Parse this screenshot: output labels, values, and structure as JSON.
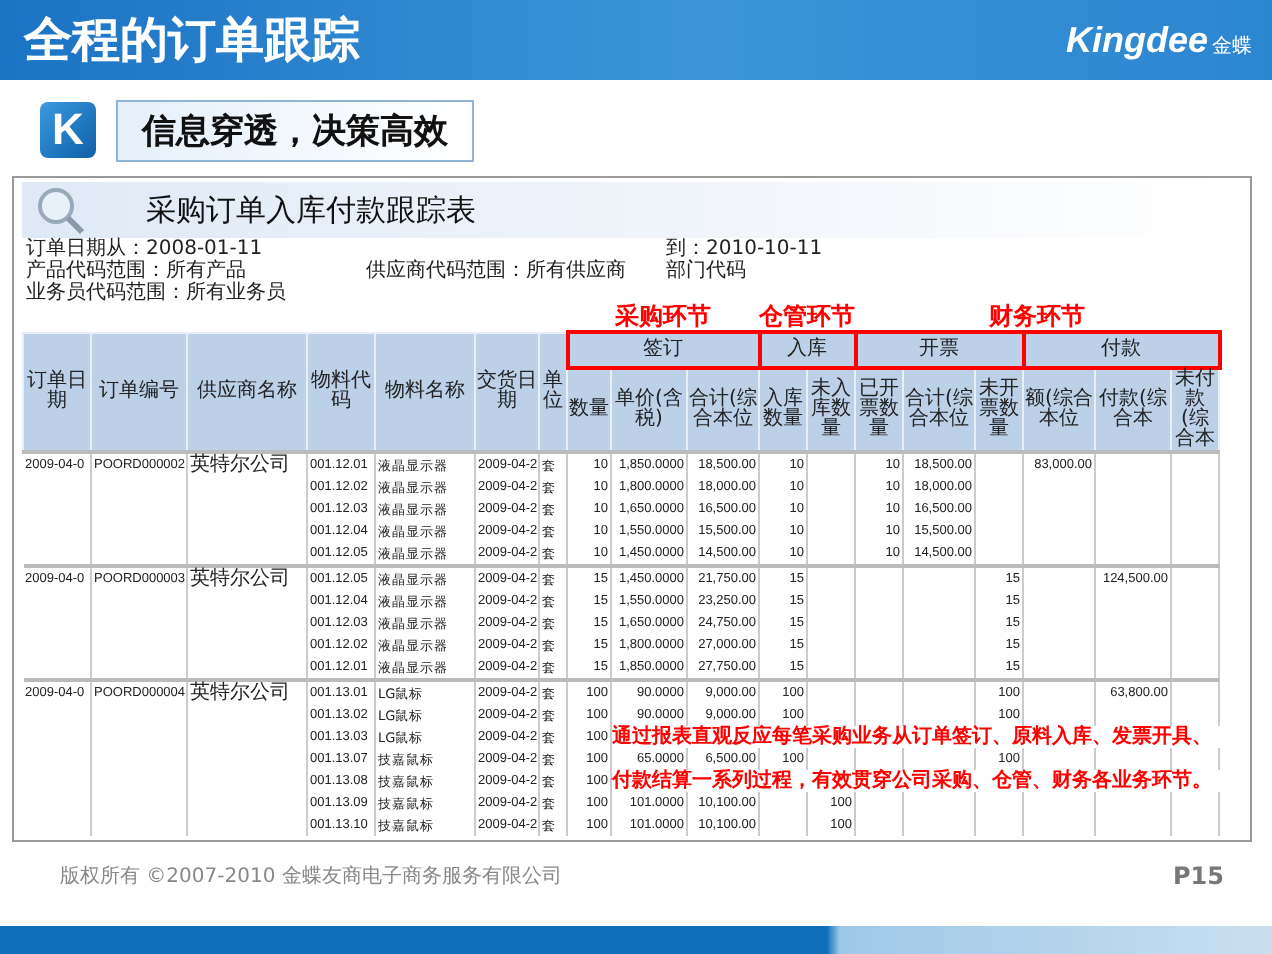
{
  "header": {
    "title": "全程的订单跟踪",
    "logo_text": "Kingdee",
    "logo_cn": "金蝶"
  },
  "subtitle": {
    "icon_letter": "K",
    "text": "信息穿透，决策高效"
  },
  "report": {
    "title": "采购订单入库付款跟踪表",
    "meta_rows": [
      [
        "订单日期从：2008-01-11",
        null,
        "到：2010-10-11"
      ],
      [
        "产品代码范围：所有产品",
        "供应商代码范围：所有供应商",
        "部门代码"
      ],
      [
        "业务员代码范围：所有业务员",
        null,
        null
      ]
    ],
    "left_columns": [
      "订单日期",
      "订单编号",
      "供应商名称",
      "物料代码",
      "物料名称",
      "交货日期",
      "单位"
    ],
    "stages": [
      {
        "label": "采购环节",
        "groups": [
          {
            "label": "签订",
            "highlighted": true,
            "columns": [
              "数量",
              "单价(含税)",
              "合计(综合本位"
            ]
          }
        ]
      },
      {
        "label": "仓管环节",
        "groups": [
          {
            "label": "入库",
            "highlighted": true,
            "columns": [
              "入库数量",
              "未入库数量"
            ]
          }
        ]
      },
      {
        "label": "财务环节",
        "groups": [
          {
            "label": "开票",
            "highlighted": true,
            "columns": [
              "已开票数量",
              "合计(综合本位",
              "未开票数量"
            ]
          },
          {
            "label": "付款",
            "highlighted": true,
            "columns": [
              "额(综合本位",
              "付款(综合本",
              "未付款(综合本"
            ]
          }
        ]
      }
    ],
    "rows": [
      {
        "kind": "data",
        "cells": [
          "2009-04-0",
          "POORD000002",
          "英特尔公司",
          "001.12.01",
          "液晶显示器",
          "2009-04-2",
          "套",
          "10",
          "1,850.0000",
          "18,500.00",
          "10",
          null,
          "10",
          "18,500.00",
          null,
          "83,000.00",
          null,
          null
        ]
      },
      {
        "kind": "data",
        "cells": [
          null,
          null,
          null,
          "001.12.02",
          "液晶显示器",
          "2009-04-2",
          "套",
          "10",
          "1,800.0000",
          "18,000.00",
          "10",
          null,
          "10",
          "18,000.00",
          null,
          null,
          null,
          null
        ]
      },
      {
        "kind": "data",
        "cells": [
          null,
          null,
          null,
          "001.12.03",
          "液晶显示器",
          "2009-04-2",
          "套",
          "10",
          "1,650.0000",
          "16,500.00",
          "10",
          null,
          "10",
          "16,500.00",
          null,
          null,
          null,
          null
        ]
      },
      {
        "kind": "data",
        "cells": [
          null,
          null,
          null,
          "001.12.04",
          "液晶显示器",
          "2009-04-2",
          "套",
          "10",
          "1,550.0000",
          "15,500.00",
          "10",
          null,
          "10",
          "15,500.00",
          null,
          null,
          null,
          null
        ]
      },
      {
        "kind": "data",
        "cells": [
          null,
          null,
          null,
          "001.12.05",
          "液晶显示器",
          "2009-04-2",
          "套",
          "10",
          "1,450.0000",
          "14,500.00",
          "10",
          null,
          "10",
          "14,500.00",
          null,
          null,
          null,
          null
        ]
      },
      {
        "kind": "data",
        "cells": [
          "2009-04-0",
          "POORD000003",
          "英特尔公司",
          "001.12.05",
          "液晶显示器",
          "2009-04-2",
          "套",
          "15",
          "1,450.0000",
          "21,750.00",
          "15",
          null,
          null,
          null,
          "15",
          null,
          "124,500.00",
          null
        ]
      },
      {
        "kind": "data",
        "cells": [
          null,
          null,
          null,
          "001.12.04",
          "液晶显示器",
          "2009-04-2",
          "套",
          "15",
          "1,550.0000",
          "23,250.00",
          "15",
          null,
          null,
          null,
          "15",
          null,
          null,
          null
        ]
      },
      {
        "kind": "data",
        "cells": [
          null,
          null,
          null,
          "001.12.03",
          "液晶显示器",
          "2009-04-2",
          "套",
          "15",
          "1,650.0000",
          "24,750.00",
          "15",
          null,
          null,
          null,
          "15",
          null,
          null,
          null
        ]
      },
      {
        "kind": "data",
        "cells": [
          null,
          null,
          null,
          "001.12.02",
          "液晶显示器",
          "2009-04-2",
          "套",
          "15",
          "1,800.0000",
          "27,000.00",
          "15",
          null,
          null,
          null,
          "15",
          null,
          null,
          null
        ]
      },
      {
        "kind": "data",
        "cells": [
          null,
          null,
          null,
          "001.12.01",
          "液晶显示器",
          "2009-04-2",
          "套",
          "15",
          "1,850.0000",
          "27,750.00",
          "15",
          null,
          null,
          null,
          "15",
          null,
          null,
          null
        ]
      },
      {
        "kind": "data",
        "cells": [
          "2009-04-0",
          "POORD000004",
          "英特尔公司",
          "001.13.01",
          "LG鼠标",
          "2009-04-2",
          "套",
          "100",
          "90.0000",
          "9,000.00",
          "100",
          null,
          null,
          null,
          "100",
          null,
          "63,800.00",
          null
        ]
      },
      {
        "kind": "data",
        "cells": [
          null,
          null,
          null,
          "001.13.02",
          "LG鼠标",
          "2009-04-2",
          "套",
          "100",
          "90.0000",
          "9,000.00",
          "100",
          null,
          null,
          null,
          "100",
          null,
          null,
          null
        ]
      },
      {
        "kind": "note",
        "cells": [
          null,
          null,
          null,
          "001.13.03",
          "LG鼠标",
          "2009-04-2",
          "套",
          "100"
        ],
        "note": "通过报表直观反应每笔采购业务从订单签订、原料入库、发票开具、"
      },
      {
        "kind": "data",
        "cells": [
          null,
          null,
          null,
          "001.13.07",
          "技嘉鼠标",
          "2009-04-2",
          "套",
          "100",
          "65.0000",
          "6,500.00",
          "100",
          null,
          null,
          null,
          "100",
          null,
          null,
          null
        ]
      },
      {
        "kind": "note",
        "cells": [
          null,
          null,
          null,
          "001.13.08",
          "技嘉鼠标",
          "2009-04-2",
          "套",
          "100"
        ],
        "note": "付款结算一系列过程，有效贯穿公司采购、仓管、财务各业务环节。"
      },
      {
        "kind": "data",
        "cells": [
          null,
          null,
          null,
          "001.13.09",
          "技嘉鼠标",
          "2009-04-2",
          "套",
          "100",
          "101.0000",
          "10,100.00",
          null,
          "100",
          null,
          null,
          null,
          null,
          null,
          null
        ]
      },
      {
        "kind": "data",
        "cells": [
          null,
          null,
          null,
          "001.13.10",
          "技嘉鼠标",
          "2009-04-2",
          "套",
          "100",
          "101.0000",
          "10,100.00",
          null,
          "100",
          null,
          null,
          null,
          null,
          null,
          null
        ]
      }
    ]
  },
  "footer": {
    "copyright": "版权所有 ©2007-2010 金蝶友商电子商务服务有限公司",
    "page": "P15"
  }
}
